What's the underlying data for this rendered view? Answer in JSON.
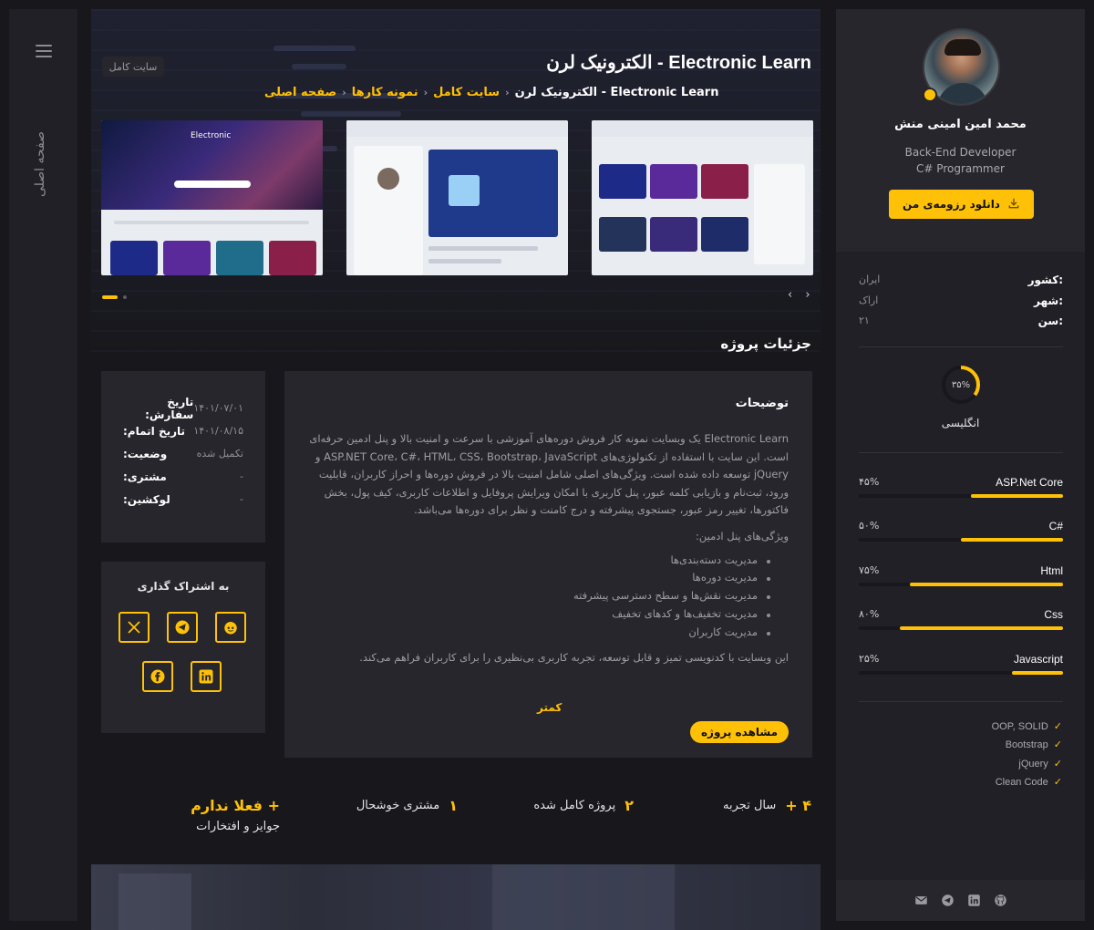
{
  "left_nav": {
    "home_label": "صفحه اصلی"
  },
  "hero": {
    "badge": "سایت کامل",
    "title": "Electronic Learn - الکترونیک لرن",
    "breadcrumb": [
      {
        "label": "صفحه اصلی"
      },
      {
        "label": "نمونه کارها"
      },
      {
        "label": "سایت کامل"
      },
      {
        "label": "Electronic Learn - الکترونیک لرن"
      }
    ],
    "thumb_logo_text": "Electronic",
    "slider_arrows": "‹ ›"
  },
  "details": {
    "heading": "جزئیات پروژه",
    "info": [
      {
        "label": "تاریخ سفارش:",
        "value": "۱۴۰۱/۰۷/۰۱"
      },
      {
        "label": "تاریخ اتمام:",
        "value": "۱۴۰۱/۰۸/۱۵"
      },
      {
        "label": "وضعیت:",
        "value": "تکمیل شده"
      },
      {
        "label": "مشتری:",
        "value": "-"
      },
      {
        "label": "لوکشین:",
        "value": "-"
      }
    ],
    "share_title": "به اشتراک گذاری",
    "share_icons": [
      "x-icon",
      "telegram-icon",
      "reddit-icon",
      "facebook-icon",
      "linkedin-icon"
    ],
    "description_title": "توضیحات",
    "description": "Electronic Learn یک وبسایت نمونه کار فروش دوره‌های آموزشی با سرعت و امنیت بالا و پنل ادمین حرفه‌ای است. این سایت با استفاده از تکنولوژی‌های ASP.NET Core، C#، HTML، CSS، Bootstrap، JavaScript و jQuery توسعه داده شده است. ویژگی‌های اصلی شامل امنیت بالا در فروش دوره‌ها و احراز کاربران، قابلیت ورود، ثبت‌نام و بازیابی کلمه عبور، پنل کاربری با امکان ویرایش پروفایل و اطلاعات کاربری، کیف پول، بخش فاکتورها، تغییر رمز عبور، جستجوی پیشرفته و درج کامنت و نظر برای دوره‌ها می‌باشد.",
    "admin_features_title": "ویژگی‌های پنل ادمین:",
    "admin_features": [
      "مدیریت دسته‌بندی‌ها",
      "مدیریت دوره‌ها",
      "مدیریت نقش‌ها و سطح دسترسی پیشرفته",
      "مدیریت تخفیف‌ها و کدهای تخفیف",
      "مدیریت کاربران"
    ],
    "footer_text": "این وبسایت با کدنویسی تمیز و قابل توسعه، تجربه کاربری بی‌نظیری را برای کاربران فراهم می‌کند.",
    "less_label": "کمتر",
    "view_project_label": "مشاهده پروژه"
  },
  "stats": [
    {
      "num": "۴ +",
      "label": "سال تجربه"
    },
    {
      "num": "۲",
      "label": "پروژه کامل شده"
    },
    {
      "num": "۱",
      "label": "مشتری خوشحال"
    }
  ],
  "awards": {
    "num": "+ فعلا ندارم",
    "label": "جوایز و افتخارات"
  },
  "profile": {
    "name": "محمد امین امینی منش",
    "role1": "Back-End Developer",
    "role2": "C# Programmer",
    "download_label": "دانلود رزومه‌ی من",
    "info": [
      {
        "label": "کشور:",
        "value": "ایران"
      },
      {
        "label": "شهر:",
        "value": "اراک"
      },
      {
        "label": "سن:",
        "value": "۲۱"
      }
    ],
    "language": {
      "name": "انگلیسی",
      "percent_label": "۳۵%",
      "percent": 35
    },
    "skills": [
      {
        "name": "ASP.Net Core",
        "pct_label": "۴۵%",
        "pct": 45
      },
      {
        "name": "C#",
        "pct_label": "۵۰%",
        "pct": 50
      },
      {
        "name": "Html",
        "pct_label": "۷۵%",
        "pct": 75
      },
      {
        "name": "Css",
        "pct_label": "۸۰%",
        "pct": 80
      },
      {
        "name": "Javascript",
        "pct_label": "۲۵%",
        "pct": 25
      }
    ],
    "tools": [
      "OOP, SOLID",
      "Bootstrap",
      "jQuery",
      "Clean Code"
    ],
    "social_icons": [
      "github-icon",
      "linkedin-icon",
      "telegram-icon",
      "email-icon"
    ]
  },
  "colors": {
    "accent": "#ffc107",
    "panel": "#26262c",
    "background": "#17171c"
  }
}
